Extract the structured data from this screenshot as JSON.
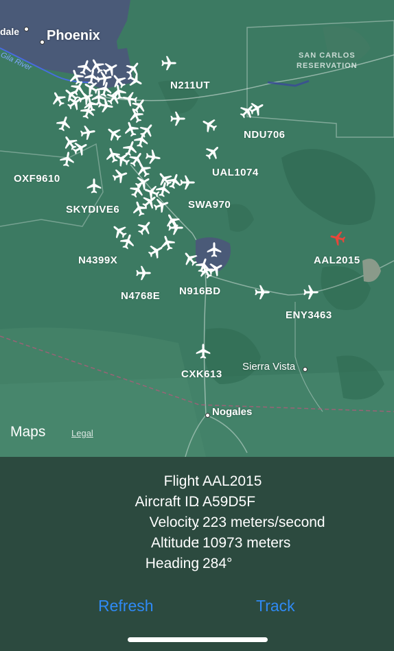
{
  "map": {
    "places": {
      "phoenix": "Phoenix",
      "dale": "dale",
      "san_carlos": "SAN CARLOS\nRESERVATION",
      "gila_river": "Gila River",
      "sierra_vista": "Sierra Vista",
      "nogales": "Nogales"
    },
    "flight_labels": [
      "N211UT",
      "NDU706",
      "UAL1074",
      "OXF9610",
      "SKYDIVE6",
      "SWA970",
      "N4399X",
      "AAL2015",
      "N916BD",
      "N4768E",
      "ENY3463",
      "CXK613"
    ],
    "selected_flight": "AAL2015",
    "colors": {
      "selected_plane": "#e8463a",
      "plane": "#ffffff"
    },
    "attribution": {
      "logo": "Maps",
      "legal": "Legal"
    }
  },
  "details": {
    "flight_label": "Flight",
    "flight_value": "AAL2015",
    "aircraft_label": "Aircraft ID",
    "aircraft_value": "A59D5F",
    "velocity_label": "Velocity",
    "velocity_value": "223 meters/second",
    "altitude_label": "Altitude",
    "altitude_value": "10973 meters",
    "heading_label": "Heading",
    "heading_value": "284°"
  },
  "actions": {
    "refresh": "Refresh",
    "track": "Track"
  }
}
